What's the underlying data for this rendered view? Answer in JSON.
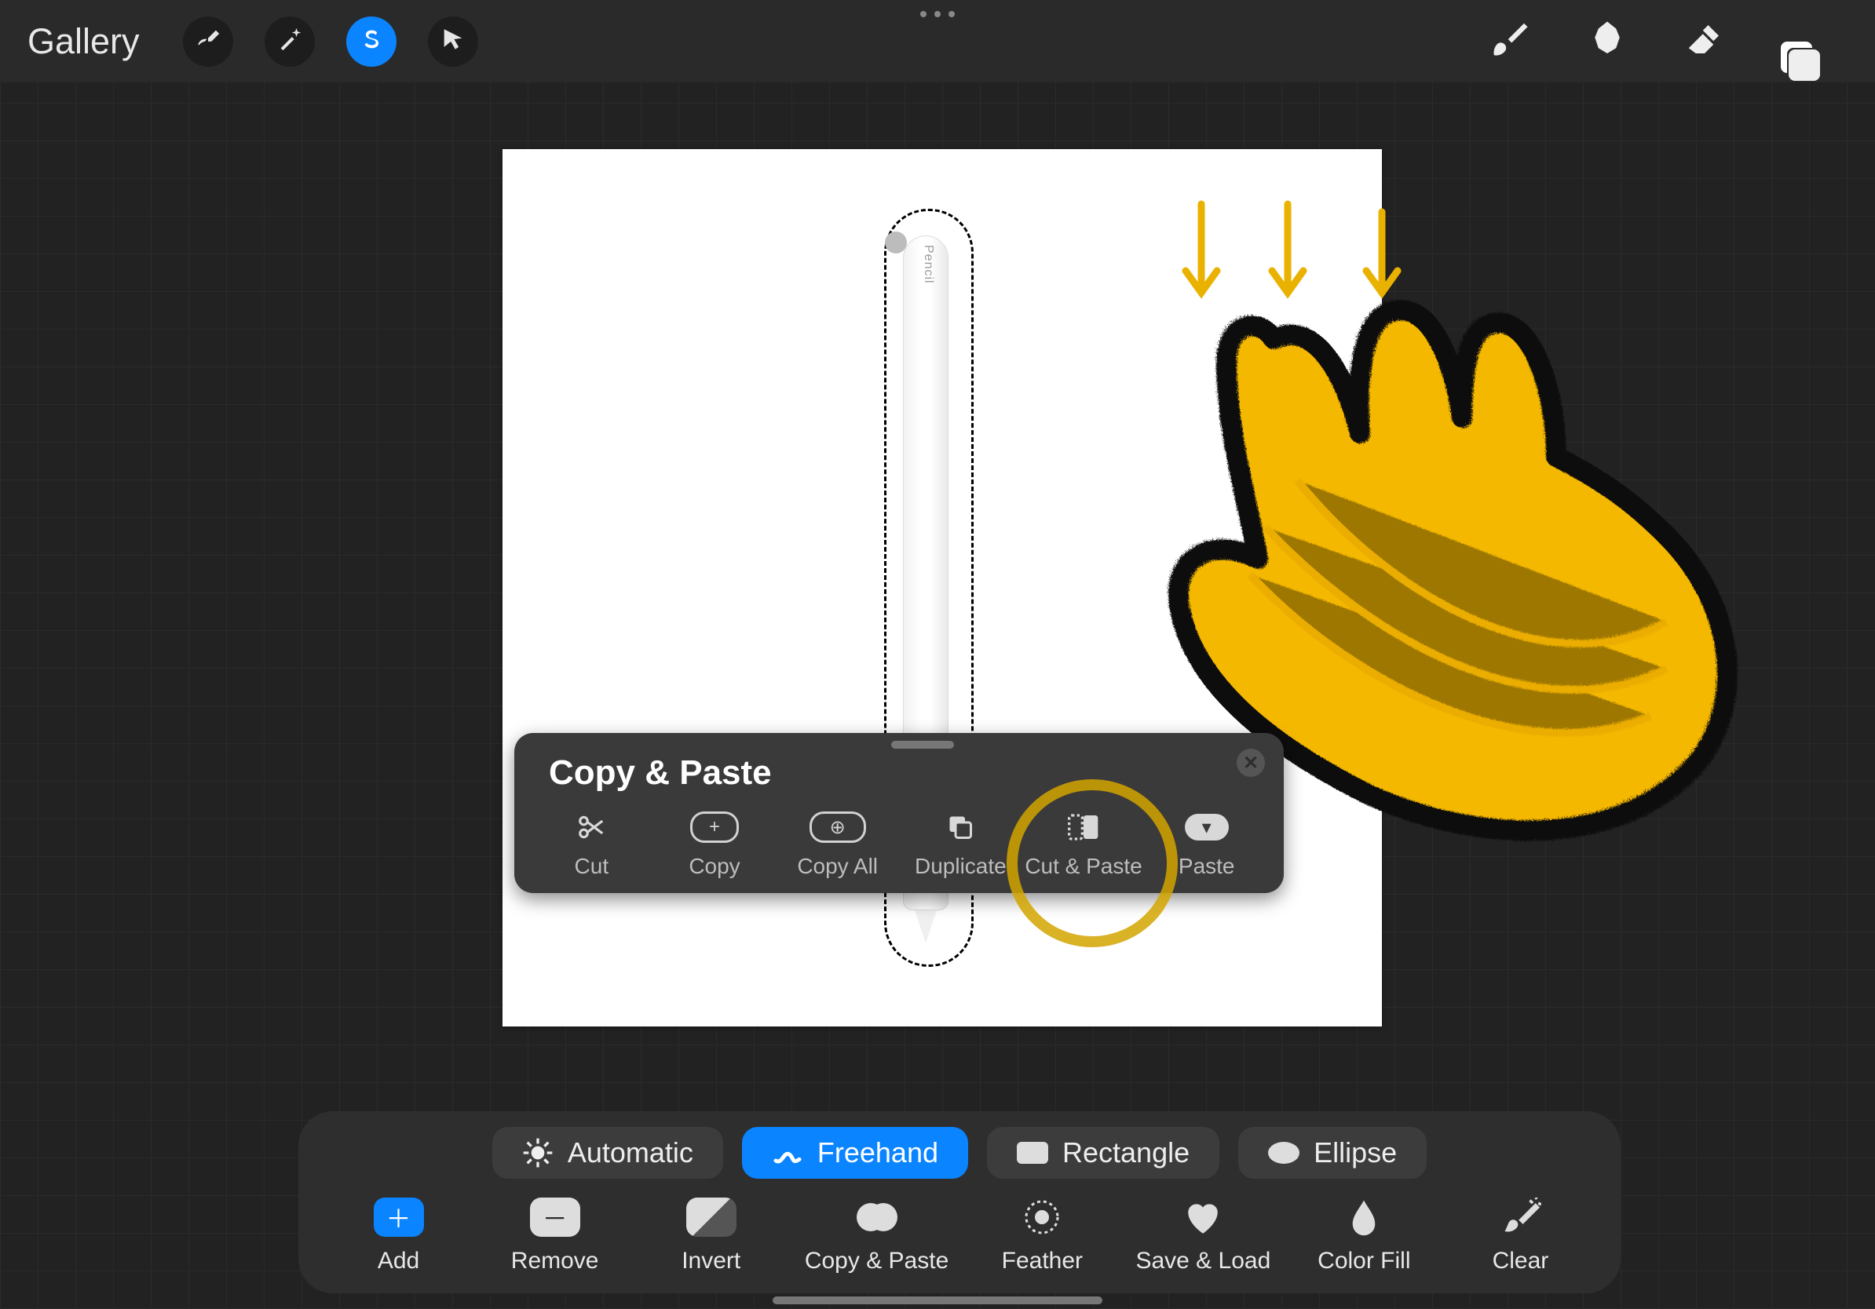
{
  "topbar": {
    "gallery_label": "Gallery"
  },
  "canvas": {
    "pencil_label": " Pencil"
  },
  "popover": {
    "title": "Copy & Paste",
    "actions": {
      "cut": "Cut",
      "copy": "Copy",
      "copy_all": "Copy All",
      "duplicate": "Duplicate",
      "cut_paste": "Cut & Paste",
      "paste": "Paste"
    }
  },
  "modes": {
    "automatic": "Automatic",
    "freehand": "Freehand",
    "rectangle": "Rectangle",
    "ellipse": "Ellipse"
  },
  "bottom_actions": {
    "add": "Add",
    "remove": "Remove",
    "invert": "Invert",
    "copy_paste": "Copy & Paste",
    "feather": "Feather",
    "save_load": "Save & Load",
    "color_fill": "Color Fill",
    "clear": "Clear"
  },
  "colors": {
    "accent": "#0a84ff",
    "annotation": "#f5b800"
  }
}
